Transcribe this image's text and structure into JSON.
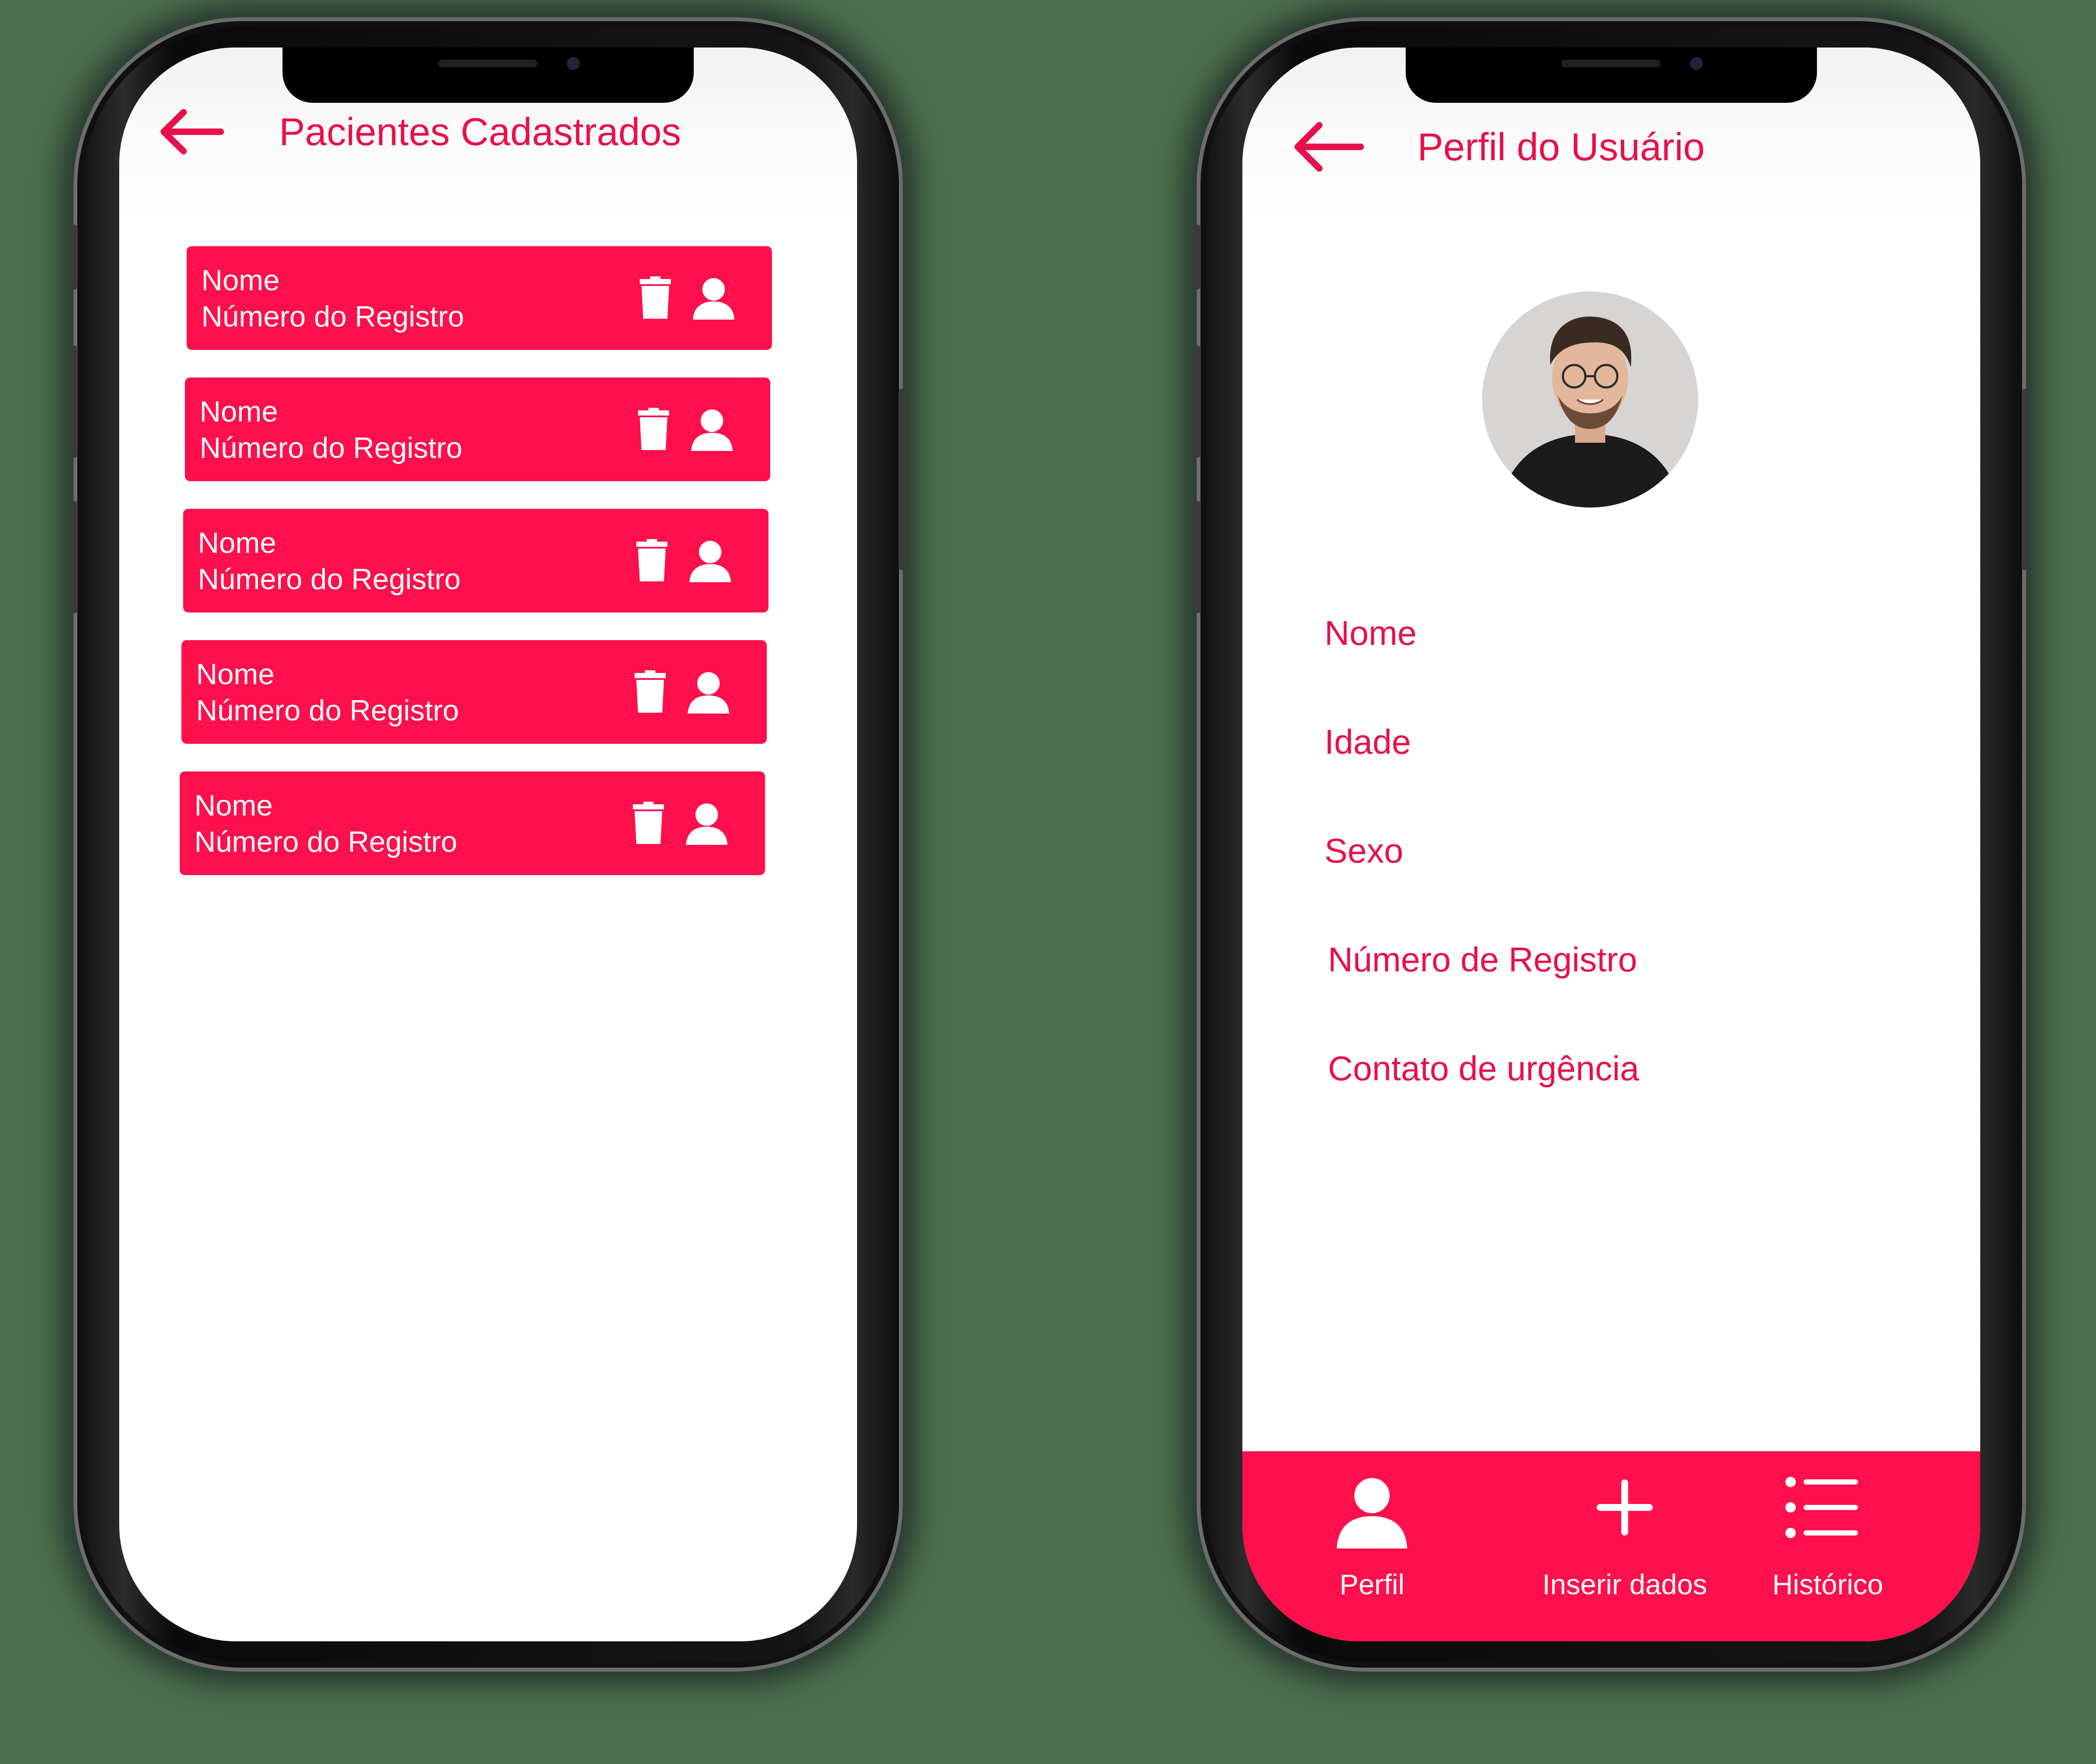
{
  "colors": {
    "accent": "#ff0f4b",
    "title": "#e8104a",
    "background": "#4b6f4c",
    "screen": "#ffffff"
  },
  "screen_left": {
    "back_icon": "arrow-left-icon",
    "title": "Pacientes Cadastrados",
    "patients": [
      {
        "name": "Nome",
        "registration": "Número do Registro",
        "delete_icon": "trash-icon",
        "profile_icon": "user-icon"
      },
      {
        "name": "Nome",
        "registration": "Número do Registro",
        "delete_icon": "trash-icon",
        "profile_icon": "user-icon"
      },
      {
        "name": "Nome",
        "registration": "Número do Registro",
        "delete_icon": "trash-icon",
        "profile_icon": "user-icon"
      },
      {
        "name": "Nome",
        "registration": "Número do Registro",
        "delete_icon": "trash-icon",
        "profile_icon": "user-icon"
      },
      {
        "name": "Nome",
        "registration": "Número do Registro",
        "delete_icon": "trash-icon",
        "profile_icon": "user-icon"
      }
    ]
  },
  "screen_right": {
    "back_icon": "arrow-left-icon",
    "title": "Perfil do Usuário",
    "fields": [
      "Nome",
      "Idade",
      "Sexo",
      "Número de Registro",
      "Contato de urgência"
    ],
    "tabs": [
      {
        "label": "Perfil",
        "icon": "user-icon"
      },
      {
        "label": "Inserir dados",
        "icon": "plus-icon"
      },
      {
        "label": "Histórico",
        "icon": "list-icon"
      }
    ]
  }
}
